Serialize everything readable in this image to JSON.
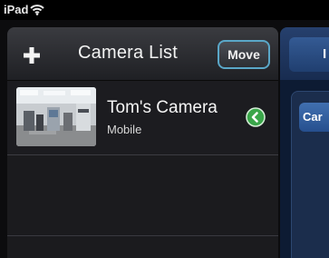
{
  "status_bar": {
    "device": "iPad",
    "wifi_icon": "wifi-icon"
  },
  "camera_list": {
    "title": "Camera List",
    "add_icon": "plus-icon",
    "move_label": "Move",
    "cameras": [
      {
        "name": "Tom's Camera",
        "subtitle": "Mobile",
        "thumbnail": "camera-thumbnail",
        "disclosure_icon": "chevron-right-circle-icon"
      }
    ]
  },
  "right_panel": {
    "top_button_label": "I",
    "tab_label": "Car"
  },
  "colors": {
    "move_border": "#5aa7c8",
    "disclosure_green": "#3aa64a",
    "right_panel_blue": "#26406d"
  }
}
